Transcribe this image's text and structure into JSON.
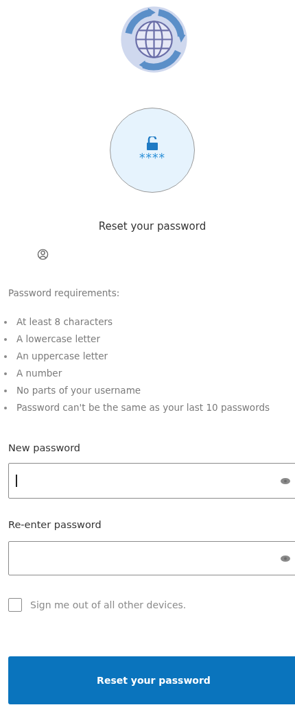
{
  "lock_badge": {
    "mask": "****"
  },
  "title": "Reset your password",
  "requirements": {
    "heading": "Password requirements:",
    "items": [
      "At least 8 characters",
      "A lowercase letter",
      "An uppercase letter",
      "A number",
      "No parts of your username",
      "Password can't be the same as your last 10 passwords"
    ]
  },
  "fields": [
    {
      "label": "New password",
      "focused": true
    },
    {
      "label": "Re-enter password",
      "focused": false
    }
  ],
  "sign_out_checkbox": {
    "label": "Sign me out of all other devices.",
    "checked": false
  },
  "submit_button": "Reset your password"
}
